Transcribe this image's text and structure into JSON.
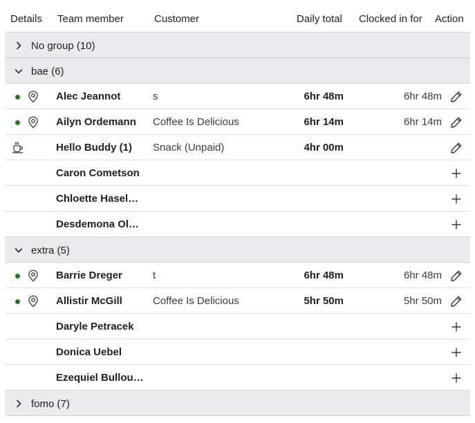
{
  "columns": {
    "details": "Details",
    "team_member": "Team member",
    "customer": "Customer",
    "daily_total": "Daily total",
    "clocked_in_for": "Clocked in for",
    "action": "Action"
  },
  "groups": [
    {
      "label": "No group (10)",
      "expanded": false,
      "members": []
    },
    {
      "label": "bae (6)",
      "expanded": true,
      "members": [
        {
          "status": "clocked-in",
          "name": "Alec Jeannot",
          "customer": "s",
          "daily_total": "6hr 48m",
          "clocked_in_for": "6hr 48m",
          "action": "edit"
        },
        {
          "status": "clocked-in",
          "name": "Ailyn Ordemann",
          "customer": "Coffee Is Delicious",
          "daily_total": "6hr 14m",
          "clocked_in_for": "6hr 14m",
          "action": "edit"
        },
        {
          "status": "on-break",
          "name": "Hello Buddy (1)",
          "customer": "Snack (Unpaid)",
          "daily_total": "4hr 00m",
          "clocked_in_for": "",
          "action": "edit"
        },
        {
          "status": "none",
          "name": "Caron Cometson",
          "customer": "",
          "daily_total": "",
          "clocked_in_for": "",
          "action": "add"
        },
        {
          "status": "none",
          "name": "Chloette Haseldine",
          "customer": "",
          "daily_total": "",
          "clocked_in_for": "",
          "action": "add"
        },
        {
          "status": "none",
          "name": "Desdemona Olek…",
          "customer": "",
          "daily_total": "",
          "clocked_in_for": "",
          "action": "add"
        }
      ]
    },
    {
      "label": "extra (5)",
      "expanded": true,
      "members": [
        {
          "status": "clocked-in",
          "name": "Barrie Dreger",
          "customer": "t",
          "daily_total": "6hr 48m",
          "clocked_in_for": "6hr 48m",
          "action": "edit"
        },
        {
          "status": "clocked-in",
          "name": "Allistir McGill",
          "customer": "Coffee Is Delicious",
          "daily_total": "5hr 50m",
          "clocked_in_for": "5hr 50m",
          "action": "edit"
        },
        {
          "status": "none",
          "name": "Daryle Petracek",
          "customer": "",
          "daily_total": "",
          "clocked_in_for": "",
          "action": "add"
        },
        {
          "status": "none",
          "name": "Donica Uebel",
          "customer": "",
          "daily_total": "",
          "clocked_in_for": "",
          "action": "add"
        },
        {
          "status": "none",
          "name": "Ezequiel Bullough",
          "customer": "",
          "daily_total": "",
          "clocked_in_for": "",
          "action": "add"
        }
      ]
    },
    {
      "label": "fomo (7)",
      "expanded": false,
      "members": []
    }
  ],
  "colors": {
    "status_dot": "#1f7a1f",
    "group_bg": "#e9e9ee"
  },
  "icons": {
    "clocked-in": [
      "status-dot-icon",
      "location-pin-icon"
    ],
    "on-break": [
      "coffee-cup-icon"
    ],
    "edit": "pencil-icon",
    "add": "plus-icon",
    "collapsed": "chevron-right-icon",
    "expanded": "chevron-down-icon"
  }
}
